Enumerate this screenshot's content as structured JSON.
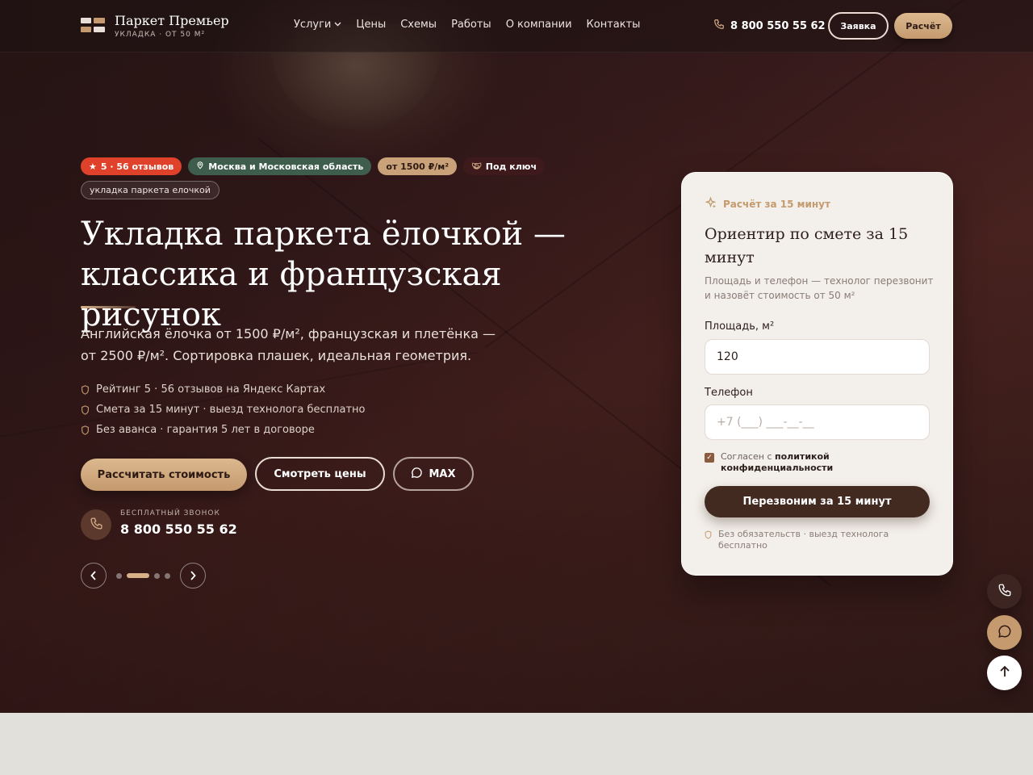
{
  "brand": {
    "title": "Паркет Премьер",
    "subtitle": "УКЛАДКА · ОТ 50 М²"
  },
  "nav": {
    "items": [
      "Услуги",
      "Цены",
      "Схемы",
      "Работы",
      "О компании",
      "Контакты"
    ]
  },
  "header": {
    "phone": "8 800 550 55 62",
    "request_label": "Заявка",
    "calc_label": "Расчёт"
  },
  "badges": {
    "rating": "5 · 56 отзывов",
    "region": "Москва и Московская область",
    "price": "от 1500 ₽/м²",
    "turnkey": "Под ключ"
  },
  "tag": "укладка паркета елочкой",
  "hero": {
    "title_line1": "Укладка паркета ёлочкой —",
    "title_line2": "классика и французская рисунок",
    "lead": "Английская ёлочка от 1500 ₽/м², французская и плетёнка — от 2500 ₽/м². Сортировка плашек, идеальная геометрия.",
    "bullets": [
      "Рейтинг 5 · 56 отзывов на Яндекс Картах",
      "Смета за 15 минут · выезд технолога бесплатно",
      "Без аванса · гарантия 5 лет в договоре"
    ],
    "btn_calc": "Рассчитать стоимость",
    "btn_prices": "Смотреть цены",
    "btn_max": "MAX",
    "call_label": "БЕСПЛАТНЫЙ ЗВОНОК",
    "call_number": "8 800 550 55 62"
  },
  "slider": {
    "slides": 4,
    "active": 2
  },
  "form": {
    "kicker": "Расчёт за 15 минут",
    "title": "Ориентир по смете за 15 минут",
    "desc": "Площадь и телефон — технолог перезвонит и назовёт стоимость от 50 м²",
    "area_label": "Площадь, м²",
    "area_value": "120",
    "phone_label": "Телефон",
    "phone_placeholder": "+7 (___) ___-__-__",
    "consent_prefix": "Согласен с ",
    "consent_link": "политикой конфиденциальности",
    "submit_label": "Перезвоним за 15 минут",
    "note": "Без обязательств · выезд технолога бесплатно"
  },
  "colors": {
    "accent": "#c49a6e",
    "dark": "#432a20",
    "red": "#e0412a",
    "green": "#3f5d4c"
  },
  "icons": [
    "logo-icon",
    "chevron-down-icon",
    "phone-icon",
    "star-icon",
    "pin-icon",
    "handshake-icon",
    "shield-icon",
    "chat-icon",
    "arrow-left-icon",
    "arrow-right-icon",
    "sparkle-icon",
    "arrow-up-icon"
  ]
}
